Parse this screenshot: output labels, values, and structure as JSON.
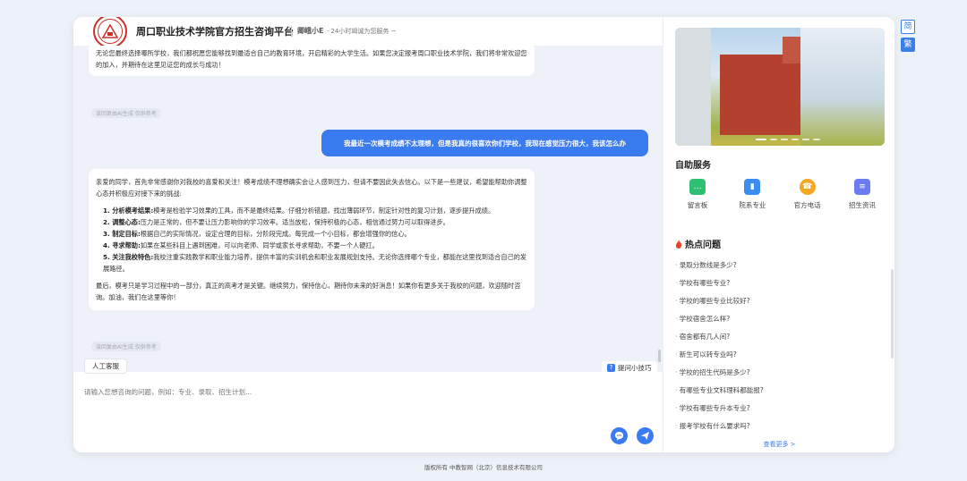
{
  "lang": {
    "simplified": "简",
    "traditional": "繁"
  },
  "header": {
    "title": "周口职业技术学院官方招生咨询平台",
    "assistant_name": "卿峨小E",
    "assistant_desc": "· 24小时竭诚为您服务 ~"
  },
  "chat": {
    "ai_note": "该回复由AI生成 仅供参考",
    "prev_ai_text": "无论您最终选择哪所学校，我们都祝愿您能够找到最适合自己的教育环境，开启精彩的大学生活。如果您决定报考周口职业技术学院，我们将非常欢迎您的加入，并期待在这里见证您的成长与成功！",
    "user_msg": "我最近一次模考成绩不太理想，但是我真的很喜欢你们学校，我现在感觉压力很大，我该怎么办",
    "ai_intro": "亲爱的同学，首先非常感谢你对我校的喜爱和关注！模考成绩不理想确实会让人感到压力，但请不要因此失去信心。以下是一些建议，希望能帮助你调整心态并积极应对接下来的挑战:",
    "tips": [
      {
        "title": "1. 分析模考结果:",
        "text": "模考是检验学习效果的工具，而不是最终结果。仔细分析错题，找出薄弱环节，制定针对性的复习计划，逐步提升成绩。"
      },
      {
        "title": "2. 调整心态:",
        "text": "压力是正常的，但不要让压力影响你的学习效率。适当放松，保持积极的心态，相信通过努力可以取得进步。"
      },
      {
        "title": "3. 制定目标:",
        "text": "根据自己的实际情况，设定合理的目标，分阶段完成。每完成一个小目标，都会增强你的信心。"
      },
      {
        "title": "4. 寻求帮助:",
        "text": "如果在某些科目上遇到困难，可以向老师、同学或家长寻求帮助，不要一个人硬扛。"
      },
      {
        "title": "5. 关注我校特色:",
        "text": "我校注重实践教学和职业能力培养，提供丰富的实训机会和职业发展规划支持。无论你选择哪个专业，都能在这里找到适合自己的发展路径。"
      }
    ],
    "ai_outro": "最后，模考只是学习过程中的一部分，真正的高考才是关键。继续努力，保持信心，期待你未来的好消息！如果你有更多关于我校的问题，欢迎随时咨询。加油，我们在这里等你！"
  },
  "bottom": {
    "human_service": "人工客服",
    "tips": "提问小技巧",
    "placeholder": "请输入您想咨询的问题，例如：专业、录取、招生计划..."
  },
  "sidebar": {
    "services_title": "自助服务",
    "services": [
      {
        "label": "留言板",
        "icon": "message-board-icon",
        "color": "#2fbf71"
      },
      {
        "label": "院系专业",
        "icon": "department-icon",
        "color": "#3b8ef0"
      },
      {
        "label": "官方电话",
        "icon": "phone-icon",
        "color": "#f5a623"
      },
      {
        "label": "招生资讯",
        "icon": "news-icon",
        "color": "#6c7cf0"
      }
    ],
    "hot_title": "热点问题",
    "hot_questions": [
      "录取分数线是多少?",
      "学校有哪些专业?",
      "学校的哪些专业比较好?",
      "学校宿舍怎么样?",
      "宿舍都有几人间?",
      "新生可以转专业吗?",
      "学校的招生代码是多少?",
      "有哪些专业文科理科都能报?",
      "学校有哪些专升本专业?",
      "报考学校有什么要求吗?"
    ],
    "see_more": "查看更多 >"
  },
  "footer": "版权所有 中教智网（北京）信息技术有限公司"
}
